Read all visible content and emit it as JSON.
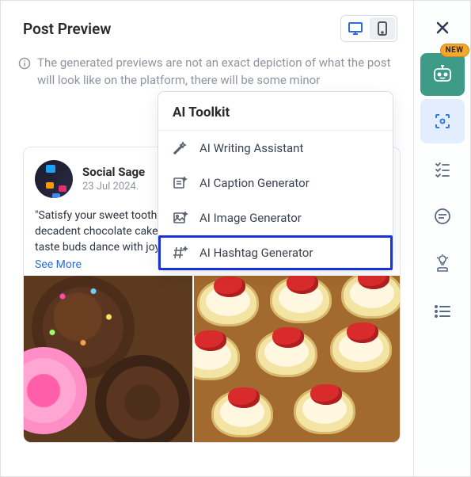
{
  "header": {
    "title": "Post Preview"
  },
  "info_text": "The generated previews are not an exact depiction of what the post will look like on the platform, there will be some minor",
  "post": {
    "author": "Social Sage",
    "date": "23 Jul 2024.",
    "body": "\"Satisfy your sweet tooth with these delicious desserts 🍰 From decadent chocolate cakes to pies 🍓 Indulge in every bite and let your taste buds dance with joy 💃 🍫",
    "see_more": "See More"
  },
  "toolkit": {
    "title": "AI Toolkit",
    "items": [
      {
        "label": "AI Writing Assistant"
      },
      {
        "label": "AI Caption Generator"
      },
      {
        "label": "AI Image Generator"
      },
      {
        "label": "AI Hashtag Generator"
      }
    ]
  },
  "sidebar": {
    "new_label": "NEW"
  }
}
